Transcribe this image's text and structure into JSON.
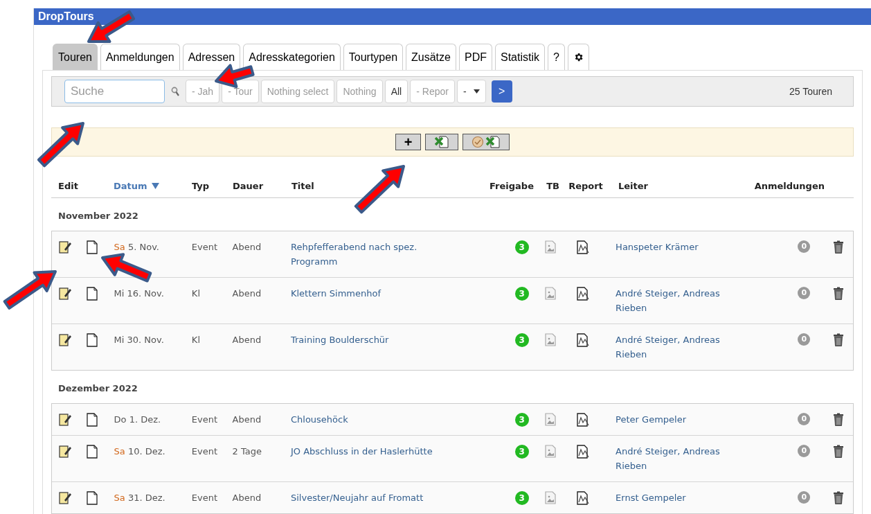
{
  "window": {
    "title": "DropTours"
  },
  "tabs": [
    {
      "kind": "text",
      "label": "Touren",
      "selected": true
    },
    {
      "kind": "text",
      "label": "Anmeldungen",
      "selected": false
    },
    {
      "kind": "text",
      "label": "Adressen",
      "selected": false
    },
    {
      "kind": "text",
      "label": "Adresskategorien",
      "selected": false
    },
    {
      "kind": "text",
      "label": "Tourtypen",
      "selected": false
    },
    {
      "kind": "text",
      "label": "Zusätze",
      "selected": false
    },
    {
      "kind": "text",
      "label": "PDF",
      "selected": false
    },
    {
      "kind": "text",
      "label": "Statistik",
      "selected": false
    },
    {
      "kind": "text",
      "label": "?",
      "selected": false
    },
    {
      "kind": "settings",
      "selected": false
    }
  ],
  "filters": {
    "search": {
      "placeholder": "Suche"
    },
    "selects": [
      {
        "value": "- Jah",
        "empty": true
      },
      {
        "value": "- Tour",
        "empty": true
      },
      {
        "value": "Nothing select",
        "empty": true
      },
      {
        "value": "Nothing",
        "empty": true
      },
      {
        "value": "All",
        "empty": false
      },
      {
        "value": "- Repor",
        "empty": true
      },
      {
        "value": "-",
        "empty": false
      }
    ],
    "go": ">",
    "count": "25 Touren"
  },
  "toolbar": [
    {
      "kind": "add",
      "label": "+"
    },
    {
      "kind": "excel"
    },
    {
      "kind": "excel-check"
    }
  ],
  "columns": [
    {
      "label": "Edit",
      "sorted": false
    },
    {
      "label": "Datum",
      "sorted": true
    },
    {
      "label": "Typ",
      "sorted": false
    },
    {
      "label": "Dauer",
      "sorted": false
    },
    {
      "label": "Titel",
      "sorted": false
    },
    {
      "label": "Freigabe",
      "sorted": false
    },
    {
      "label": "TB",
      "sorted": false
    },
    {
      "label": "Report",
      "sorted": false
    },
    {
      "label": "Leiter",
      "sorted": false
    },
    {
      "label": "Anmeldungen",
      "sorted": false
    }
  ],
  "groups": [
    {
      "title": "November 2022",
      "rows": [
        {
          "weekday": "Sa",
          "weekend": true,
          "date": "5. Nov.",
          "typ": "Event",
          "dauer": "Abend",
          "titel": "Rehpfefferabend nach spez. Programm",
          "freigabe": "3",
          "leiter": "Hanspeter Krämer",
          "anmeldungen": "0"
        },
        {
          "weekday": "Mi",
          "weekend": false,
          "date": "16. Nov.",
          "typ": "Kl",
          "dauer": "Abend",
          "titel": "Klettern Simmenhof",
          "freigabe": "3",
          "leiter": "André Steiger, Andreas Rieben",
          "anmeldungen": "0"
        },
        {
          "weekday": "Mi",
          "weekend": false,
          "date": "30. Nov.",
          "typ": "Kl",
          "dauer": "Abend",
          "titel": "Training Boulderschür",
          "freigabe": "3",
          "leiter": "André Steiger, Andreas Rieben",
          "anmeldungen": "0"
        }
      ]
    },
    {
      "title": "Dezember 2022",
      "rows": [
        {
          "weekday": "Do",
          "weekend": false,
          "date": "1. Dez.",
          "typ": "Event",
          "dauer": "Abend",
          "titel": "Chlousehöck",
          "freigabe": "3",
          "leiter": "Peter Gempeler",
          "anmeldungen": "0"
        },
        {
          "weekday": "Sa",
          "weekend": true,
          "date": "10. Dez.",
          "typ": "Event",
          "dauer": "2 Tage",
          "titel": "JO Abschluss in der Haslerhütte",
          "freigabe": "3",
          "leiter": "André Steiger, Andreas Rieben",
          "anmeldungen": "0"
        },
        {
          "weekday": "Sa",
          "weekend": true,
          "date": "31. Dez.",
          "typ": "Event",
          "dauer": "Abend",
          "titel": "Silvester/Neujahr auf Fromatt",
          "freigabe": "3",
          "leiter": "Ernst Gempeler",
          "anmeldungen": "0"
        }
      ]
    }
  ],
  "annotations": [
    {
      "kind": "arrow"
    },
    {
      "kind": "arrow"
    },
    {
      "kind": "arrow"
    },
    {
      "kind": "arrow"
    },
    {
      "kind": "arrow"
    },
    {
      "kind": "arrow"
    }
  ]
}
